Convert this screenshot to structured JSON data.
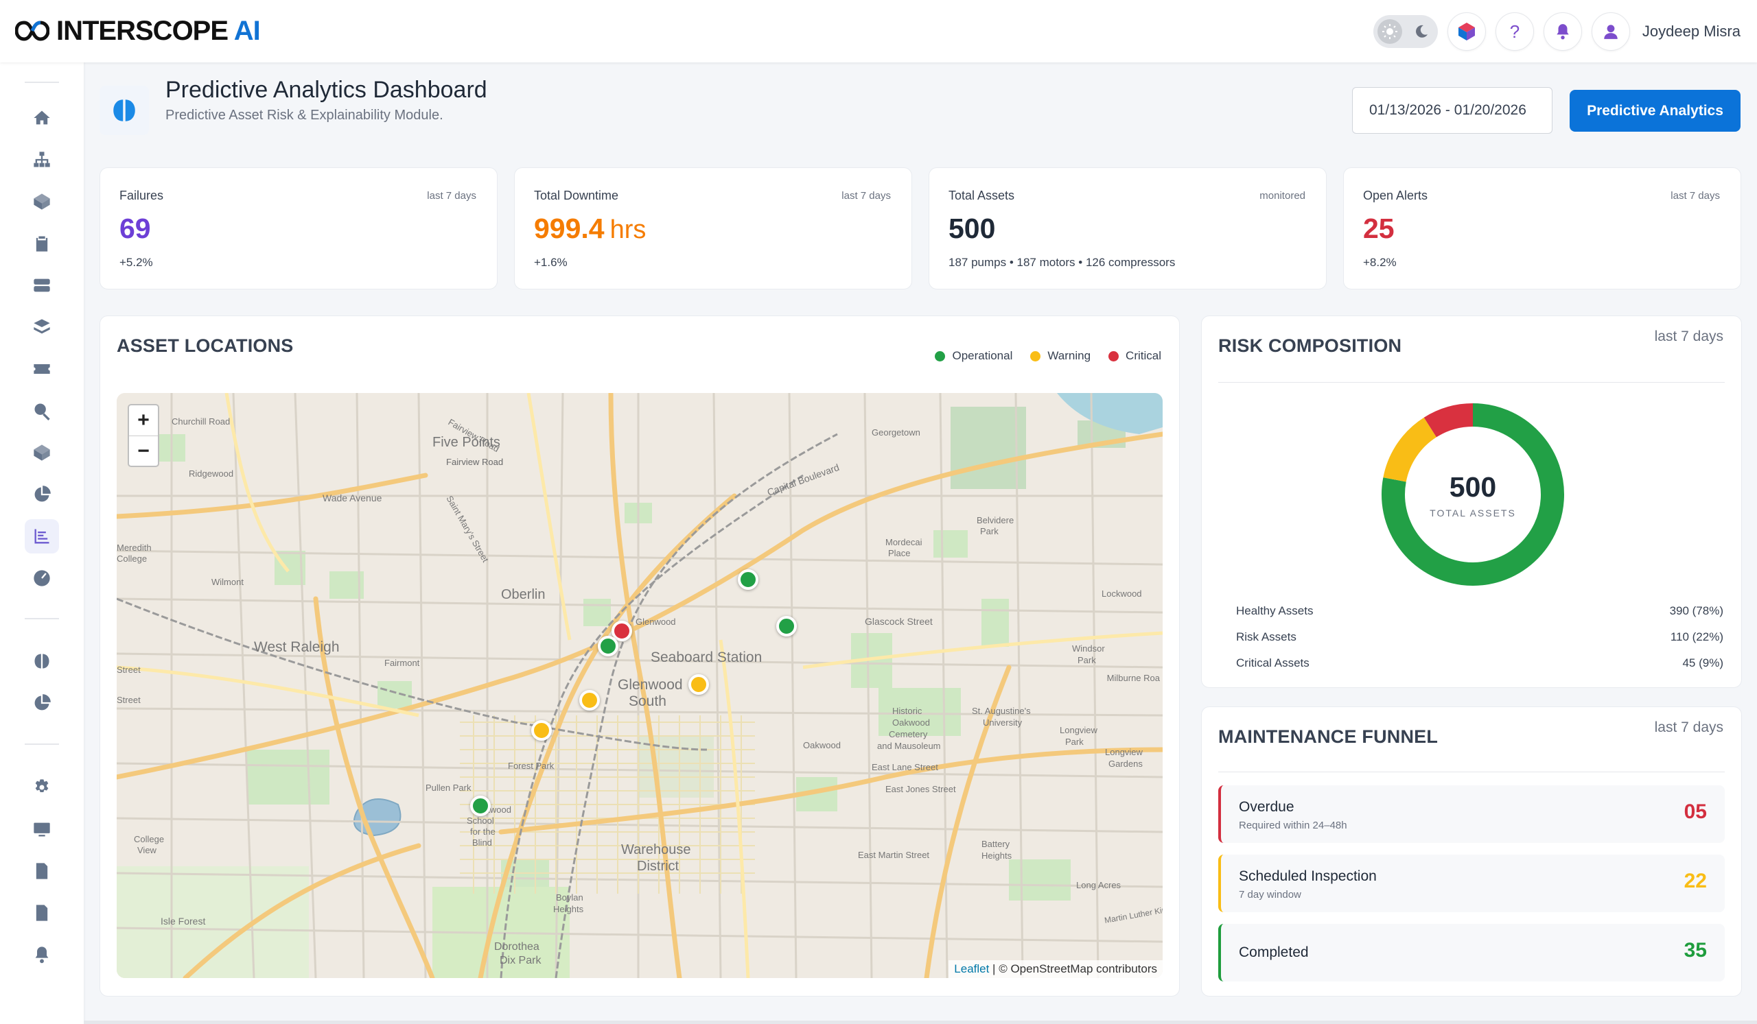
{
  "app": {
    "brand": "INTERSCOPE",
    "brand_suffix": "AI",
    "user_name": "Joydeep Misra"
  },
  "header": {
    "title": "Predictive Analytics Dashboard",
    "subtitle": "Predictive Asset Risk & Explainability Module.",
    "date_range": "01/13/2026 - 01/20/2026",
    "cta_label": "Predictive Analytics"
  },
  "kpis": [
    {
      "label": "Failures",
      "period": "last 7 days",
      "value": "69",
      "unit": "",
      "delta": "+5.2%",
      "color": "#6d3fd6"
    },
    {
      "label": "Total Downtime",
      "period": "last 7 days",
      "value": "999.4",
      "unit": "hrs",
      "delta": "+1.6%",
      "color": "#f57c00"
    },
    {
      "label": "Total Assets",
      "period": "monitored",
      "value": "500",
      "unit": "",
      "delta": "187 pumps • 187 motors • 126 compressors",
      "color": "#1f2937"
    },
    {
      "label": "Open Alerts",
      "period": "last 7 days",
      "value": "25",
      "unit": "",
      "delta": "+8.2%",
      "color": "#d32f3f"
    }
  ],
  "asset_locations": {
    "title": "ASSET LOCATIONS",
    "legend": [
      {
        "label": "Operational",
        "color": "#22a046"
      },
      {
        "label": "Warning",
        "color": "#f9bd16"
      },
      {
        "label": "Critical",
        "color": "#d9313f"
      }
    ],
    "map": {
      "attribution_leaflet": "Leaflet",
      "attribution_rest": " | © OpenStreetMap contributors",
      "zoom_in": "+",
      "zoom_out": "−",
      "labels": [
        "Five Points",
        "Oberlin",
        "West Raleigh",
        "Seaboard Station",
        "Glenwood South",
        "Warehouse District",
        "Isle Forest",
        "Dorothea Dix Park",
        "Wade Avenue",
        "Capital Boulevard",
        "Glascock Street",
        "East Lane Street",
        "East Martin Street",
        "Georgetown",
        "Mordecai Place",
        "Belvidere Park",
        "Ridgewood",
        "Wilmont",
        "Fairmont",
        "Historic Oakwood Cemetery",
        "Churchill Road",
        "Oakwood",
        "Boylan Heights",
        "Battery Heights",
        "Long Acres",
        "Lockwood",
        "Longview Park",
        "Windsor Park",
        "Meredith College",
        "College View",
        "Pullen Park",
        "Forest Park",
        "Glenwood",
        "East Jones Street"
      ]
    },
    "markers": [
      {
        "status": "operational",
        "color": "#22a046"
      },
      {
        "status": "operational",
        "color": "#22a046"
      },
      {
        "status": "critical",
        "color": "#d9313f"
      },
      {
        "status": "operational",
        "color": "#22a046"
      },
      {
        "status": "warning",
        "color": "#f9bd16"
      },
      {
        "status": "warning",
        "color": "#f9bd16"
      },
      {
        "status": "warning",
        "color": "#f9bd16"
      },
      {
        "status": "operational",
        "color": "#22a046"
      }
    ]
  },
  "risk_composition": {
    "title": "RISK COMPOSITION",
    "period": "last 7 days",
    "total": "500",
    "total_caption": "TOTAL ASSETS",
    "rows": [
      {
        "label": "Healthy Assets",
        "value": "390 (78%)"
      },
      {
        "label": "Risk Assets",
        "value": "110 (22%)"
      },
      {
        "label": "Critical Assets",
        "value": "45 (9%)"
      }
    ]
  },
  "chart_data": {
    "type": "pie",
    "categories": [
      "Healthy",
      "Warning",
      "Critical"
    ],
    "values": [
      390,
      65,
      45
    ],
    "colors": [
      "#22a046",
      "#f9bd16",
      "#d9313f"
    ],
    "title": ""
  },
  "maintenance_funnel": {
    "title": "MAINTENANCE FUNNEL",
    "period": "last 7 days",
    "items": [
      {
        "title": "Overdue",
        "subtitle": "Required within 24–48h",
        "value": "05",
        "color": "#d32f3f"
      },
      {
        "title": "Scheduled Inspection",
        "subtitle": "7 day window",
        "value": "22",
        "color": "#f9bd16"
      },
      {
        "title": "Completed",
        "subtitle": "",
        "value": "35",
        "color": "#1f9d3d"
      }
    ]
  },
  "icons": {
    "theme_sun": "sun-icon",
    "theme_moon": "moon-icon",
    "help": "question-icon",
    "notifications": "bell-icon",
    "profile": "user-icon"
  }
}
